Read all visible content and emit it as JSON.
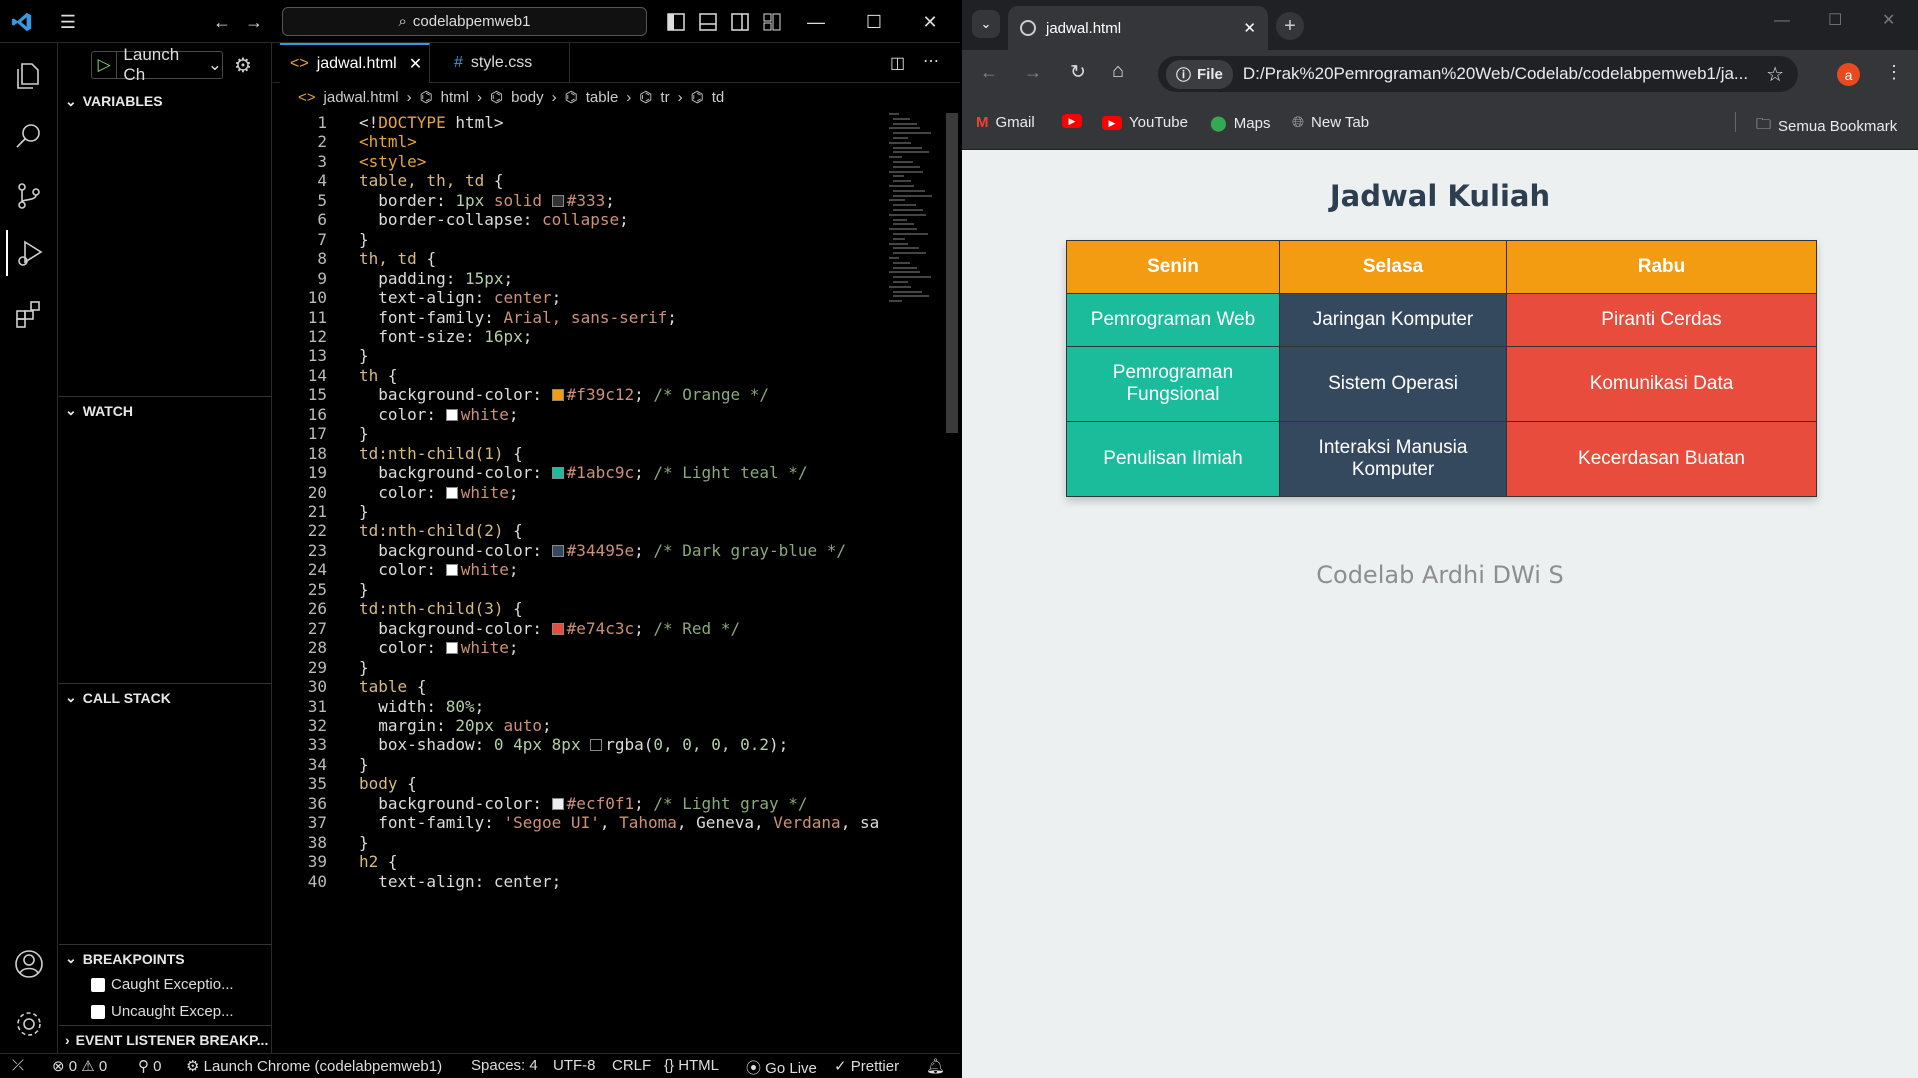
{
  "vscode": {
    "command_center": "codelabpemweb1",
    "run_config": "Launch Ch",
    "sections": {
      "variables": "VARIABLES",
      "watch": "WATCH",
      "call_stack": "CALL STACK",
      "breakpoints": "BREAKPOINTS",
      "event_listener": "EVENT LISTENER BREAKP..."
    },
    "breakpoints": [
      "Caught Exceptio...",
      "Uncaught Excep..."
    ],
    "tabs": [
      {
        "label": "jadwal.html",
        "icon": "<>"
      },
      {
        "label": "style.css",
        "icon": "#"
      }
    ],
    "breadcrumb": [
      "jadwal.html",
      "html",
      "body",
      "table",
      "tr",
      "td"
    ],
    "code_lines": [
      "1",
      "2",
      "3",
      "4",
      "5",
      "6",
      "7",
      "8",
      "9",
      "10",
      "11",
      "12",
      "13",
      "14",
      "15",
      "16",
      "17",
      "18",
      "19",
      "20",
      "21",
      "22",
      "23",
      "24",
      "25",
      "26",
      "27",
      "28",
      "29",
      "30",
      "31",
      "32",
      "33",
      "34",
      "35",
      "36",
      "37",
      "38",
      "39",
      "40"
    ],
    "status": {
      "errors": "0",
      "warnings": "0",
      "ports": "0",
      "launch": "Launch Chrome (codelabpemweb1)",
      "spaces": "Spaces: 4",
      "encoding": "UTF-8",
      "eol": "CRLF",
      "language": "HTML",
      "golive": "Go Live",
      "prettier": "Prettier"
    }
  },
  "chrome": {
    "tab_title": "jadwal.html",
    "url_scheme": "File",
    "url": "D:/Prak%20Pemrograman%20Web/Codelab/codelabpemweb1/ja...",
    "profile_initial": "a",
    "bookmarks": [
      "Gmail",
      "YouTube",
      "Maps",
      "New Tab"
    ],
    "all_bookmarks": "Semua Bookmark"
  },
  "page": {
    "title": "Jadwal Kuliah",
    "headers": [
      "Senin",
      "Selasa",
      "Rabu"
    ],
    "rows": [
      [
        "Pemrograman Web",
        "Jaringan Komputer",
        "Piranti Cerdas"
      ],
      [
        "Pemrograman Fungsional",
        "Sistem Operasi",
        "Komunikasi Data"
      ],
      [
        "Penulisan Ilmiah",
        "Interaksi Manusia Komputer",
        "Kecerdasan Buatan"
      ]
    ],
    "footer": "Codelab Ardhi DWi S"
  },
  "colors": {
    "orange": "#f39c12",
    "teal": "#1abc9c",
    "dark_blue": "#34495e",
    "red": "#e74c3c",
    "bg": "#ecf0f1",
    "heading": "#2c3e50"
  }
}
